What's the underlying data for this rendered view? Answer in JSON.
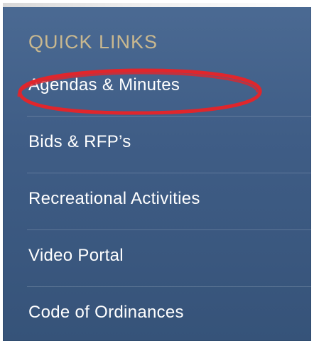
{
  "quick_links": {
    "heading": "QUICK LINKS",
    "items": [
      {
        "label": "Agendas & Minutes"
      },
      {
        "label": "Bids & RFP’s"
      },
      {
        "label": "Recreational Activities"
      },
      {
        "label": "Video Portal"
      },
      {
        "label": "Code of Ordinances"
      }
    ]
  },
  "colors": {
    "panel_bg": "#3f5d86",
    "heading": "#c9b88f",
    "link_text": "#ffffff",
    "annotation": "#e0262c"
  }
}
